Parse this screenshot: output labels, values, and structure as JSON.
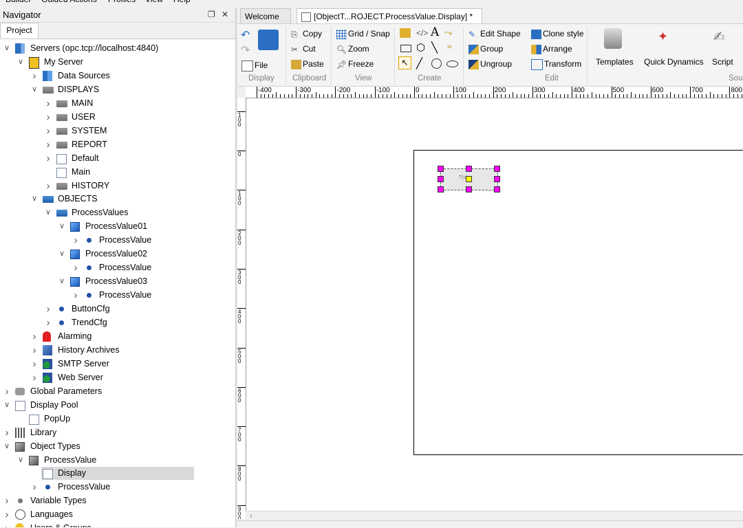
{
  "menu": [
    "Builder",
    "Guided Actions",
    "Profiles",
    "View",
    "Help"
  ],
  "navigator": {
    "title": "Navigator",
    "tab": "Project",
    "tree": [
      {
        "label": "Servers (opc.tcp://localhost:4840)",
        "icon": "server-icon",
        "depth": 0,
        "chevron": "down"
      },
      {
        "label": "My Server",
        "icon": "my-server-icon",
        "depth": 1,
        "chevron": "down"
      },
      {
        "label": "Data Sources",
        "icon": "data-sources-icon",
        "depth": 2,
        "chevron": "right"
      },
      {
        "label": "DISPLAYS",
        "icon": "folder-icon",
        "depth": 2,
        "chevron": "down"
      },
      {
        "label": "MAIN",
        "icon": "folder-icon",
        "depth": 3,
        "chevron": "right"
      },
      {
        "label": "USER",
        "icon": "folder-icon",
        "depth": 3,
        "chevron": "right"
      },
      {
        "label": "SYSTEM",
        "icon": "folder-icon",
        "depth": 3,
        "chevron": "right"
      },
      {
        "label": "REPORT",
        "icon": "folder-icon",
        "depth": 3,
        "chevron": "right"
      },
      {
        "label": "Default",
        "icon": "display-icon",
        "depth": 3,
        "chevron": "right"
      },
      {
        "label": "Main",
        "icon": "display-icon",
        "depth": 3,
        "chevron": ""
      },
      {
        "label": "HISTORY",
        "icon": "folder-icon",
        "depth": 3,
        "chevron": "right"
      },
      {
        "label": "OBJECTS",
        "icon": "folder-blue-icon",
        "depth": 2,
        "chevron": "down"
      },
      {
        "label": "ProcessValues",
        "icon": "folder-blue-icon",
        "depth": 3,
        "chevron": "down"
      },
      {
        "label": "ProcessValue01",
        "icon": "cube-icon",
        "depth": 4,
        "chevron": "down"
      },
      {
        "label": "ProcessValue",
        "icon": "dot-icon",
        "depth": 5,
        "chevron": "right"
      },
      {
        "label": "ProcessValue02",
        "icon": "cube-icon",
        "depth": 4,
        "chevron": "down"
      },
      {
        "label": "ProcessValue",
        "icon": "dot-icon",
        "depth": 5,
        "chevron": "right"
      },
      {
        "label": "ProcessValue03",
        "icon": "cube-icon",
        "depth": 4,
        "chevron": "down"
      },
      {
        "label": "ProcessValue",
        "icon": "dot-icon",
        "depth": 5,
        "chevron": "right"
      },
      {
        "label": "ButtonCfg",
        "icon": "dot-icon",
        "depth": 3,
        "chevron": "right"
      },
      {
        "label": "TrendCfg",
        "icon": "dot-icon",
        "depth": 3,
        "chevron": "right"
      },
      {
        "label": "Alarming",
        "icon": "alarm-icon",
        "depth": 2,
        "chevron": "right"
      },
      {
        "label": "History Archives",
        "icon": "book-icon",
        "depth": 2,
        "chevron": "right"
      },
      {
        "label": "SMTP Server",
        "icon": "smtp-icon",
        "depth": 2,
        "chevron": "right"
      },
      {
        "label": "Web Server",
        "icon": "web-icon",
        "depth": 2,
        "chevron": "right"
      },
      {
        "label": "Global Parameters",
        "icon": "camera-icon",
        "depth": 0,
        "chevron": "right"
      },
      {
        "label": "Display Pool",
        "icon": "display-pool-icon",
        "depth": 0,
        "chevron": "down"
      },
      {
        "label": "PopUp",
        "icon": "display-icon",
        "depth": 1,
        "chevron": ""
      },
      {
        "label": "Library",
        "icon": "library-icon",
        "depth": 0,
        "chevron": "right"
      },
      {
        "label": "Object Types",
        "icon": "cube-gray-icon",
        "depth": 0,
        "chevron": "down"
      },
      {
        "label": "ProcessValue",
        "icon": "cube-gray-icon",
        "depth": 1,
        "chevron": "down"
      },
      {
        "label": "Display",
        "icon": "display-icon",
        "depth": 2,
        "chevron": "",
        "selected": true
      },
      {
        "label": "ProcessValue",
        "icon": "dot-icon",
        "depth": 2,
        "chevron": "right"
      },
      {
        "label": "Variable Types",
        "icon": "dot-gray-icon",
        "depth": 0,
        "chevron": "right"
      },
      {
        "label": "Languages",
        "icon": "language-icon",
        "depth": 0,
        "chevron": "right"
      },
      {
        "label": "Users & Groups",
        "icon": "user-icon",
        "depth": 0,
        "chevron": "right"
      }
    ]
  },
  "editor": {
    "tabs": [
      {
        "label": "Welcome",
        "active": false
      },
      {
        "label": "[ObjectT...ROJECT.ProcessValue.Display] *",
        "active": true
      }
    ],
    "ribbon": {
      "display": {
        "file": "File",
        "group": "Display"
      },
      "clipboard": {
        "copy": "Copy",
        "cut": "Cut",
        "paste": "Paste",
        "group": "Clipboard"
      },
      "view": {
        "grid": "Grid / Snap",
        "zoom": "Zoom",
        "freeze": "Freeze",
        "group": "View"
      },
      "create": {
        "group": "Create"
      },
      "edit": {
        "edit_shape": "Edit Shape",
        "group_btn": "Group",
        "ungroup": "Ungroup",
        "clone": "Clone style",
        "arrange": "Arrange",
        "transform": "Transform",
        "group": "Edit"
      },
      "templates": "Templates",
      "quick_dynamics": "Quick Dynamics",
      "script": "Script",
      "source_group": "Sou"
    },
    "ruler_labels": [
      "-400",
      "-300",
      "-200",
      "-100",
      "0",
      "100",
      "200",
      "300",
      "400",
      "500",
      "600",
      "700",
      "800"
    ],
    "vruler_labels": [
      "100",
      "0",
      "100",
      "200",
      "300",
      "400",
      "500",
      "600",
      "700",
      "800",
      "900"
    ],
    "canvas_object_text": "T(c)"
  }
}
